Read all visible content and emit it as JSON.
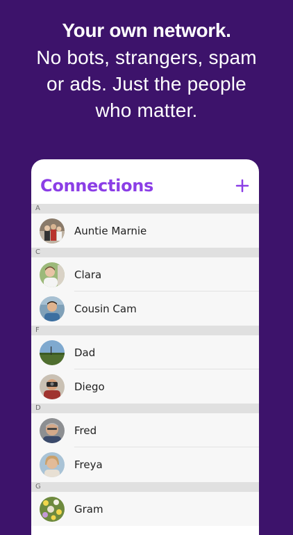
{
  "headline": {
    "bold": "Your own network.",
    "sub": "No bots, strangers, spam or ads. Just the people who matter."
  },
  "app": {
    "title": "Connections",
    "add_icon": "plus-icon",
    "accent": "#8b3ee6",
    "background": "#3d136b"
  },
  "sections": [
    {
      "letter": "A",
      "contacts": [
        {
          "name": "Auntie Marnie"
        }
      ]
    },
    {
      "letter": "C",
      "contacts": [
        {
          "name": "Clara"
        },
        {
          "name": "Cousin Cam"
        }
      ]
    },
    {
      "letter": "F",
      "contacts": [
        {
          "name": "Dad"
        },
        {
          "name": "Diego"
        }
      ]
    },
    {
      "letter": "D",
      "contacts": [
        {
          "name": "Fred"
        },
        {
          "name": "Freya"
        }
      ]
    },
    {
      "letter": "G",
      "contacts": [
        {
          "name": "Gram"
        }
      ]
    }
  ]
}
